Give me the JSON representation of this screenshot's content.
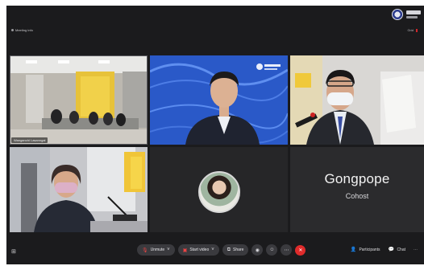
{
  "header": {
    "meeting_info": "Meeting info",
    "view_label": "Grid"
  },
  "tiles": [
    {
      "name": "Wanganchi Lasanngai",
      "kind": "video"
    },
    {
      "name": "",
      "kind": "video"
    },
    {
      "name": "",
      "kind": "video"
    },
    {
      "name": "",
      "kind": "video"
    },
    {
      "name": "",
      "kind": "avatar"
    },
    {
      "name": "Gongpope",
      "role": "Cohost",
      "kind": "name-card"
    }
  ],
  "toolbar": {
    "unmute_label": "Unmute",
    "start_video_label": "Start video",
    "share_label": "Share",
    "participants_label": "Participants",
    "chat_label": "Chat"
  },
  "colors": {
    "background": "#1b1b1d",
    "end_call": "#e02b2b",
    "muted_icon": "#e44444"
  }
}
